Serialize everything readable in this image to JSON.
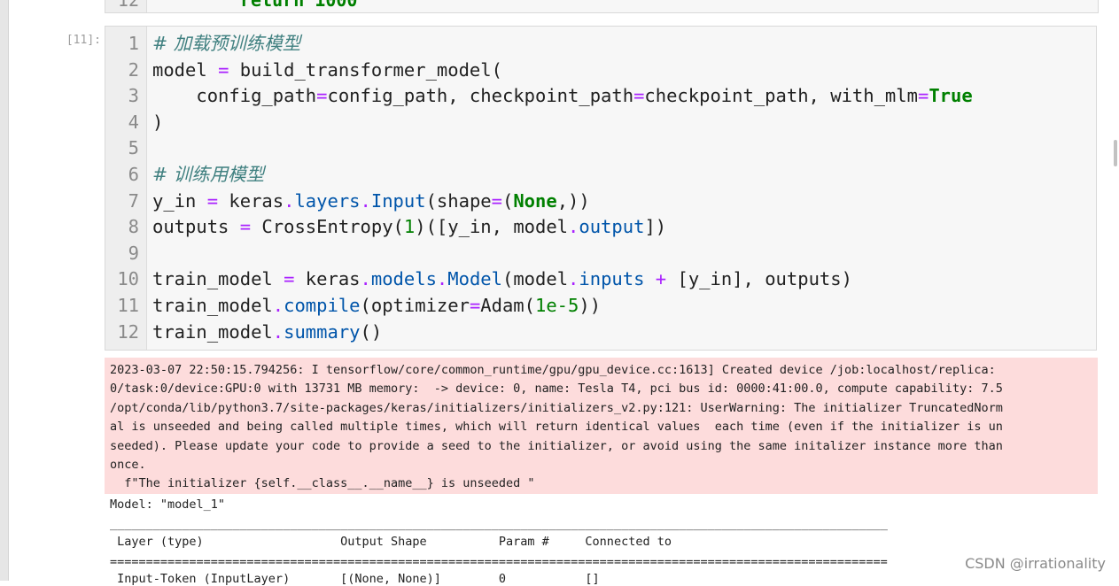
{
  "prev_cell": {
    "line_number": "12",
    "code": "return 1000"
  },
  "cell": {
    "prompt": "[11]:",
    "lines": [
      {
        "num": "1",
        "tokens": [
          {
            "t": "# 加载预训练模型",
            "c": "cm"
          }
        ]
      },
      {
        "num": "2",
        "tokens": [
          {
            "t": "model "
          },
          {
            "t": "=",
            "c": "op"
          },
          {
            "t": " build_transformer_model("
          }
        ]
      },
      {
        "num": "3",
        "tokens": [
          {
            "t": "    config_path"
          },
          {
            "t": "=",
            "c": "op"
          },
          {
            "t": "config_path, checkpoint_path"
          },
          {
            "t": "=",
            "c": "op"
          },
          {
            "t": "checkpoint_path, with_mlm"
          },
          {
            "t": "=",
            "c": "op"
          },
          {
            "t": "True",
            "c": "kw"
          }
        ]
      },
      {
        "num": "4",
        "tokens": [
          {
            "t": ")"
          }
        ]
      },
      {
        "num": "5",
        "tokens": []
      },
      {
        "num": "6",
        "tokens": [
          {
            "t": "# 训练用模型",
            "c": "cm"
          }
        ]
      },
      {
        "num": "7",
        "tokens": [
          {
            "t": "y_in "
          },
          {
            "t": "=",
            "c": "op"
          },
          {
            "t": " keras"
          },
          {
            "t": ".",
            "c": "op"
          },
          {
            "t": "layers",
            "c": "attr"
          },
          {
            "t": ".",
            "c": "op"
          },
          {
            "t": "Input",
            "c": "attr"
          },
          {
            "t": "(shape"
          },
          {
            "t": "=",
            "c": "op"
          },
          {
            "t": "("
          },
          {
            "t": "None",
            "c": "kw"
          },
          {
            "t": ",))"
          }
        ]
      },
      {
        "num": "8",
        "tokens": [
          {
            "t": "outputs "
          },
          {
            "t": "=",
            "c": "op"
          },
          {
            "t": " CrossEntropy("
          },
          {
            "t": "1",
            "c": "num"
          },
          {
            "t": ")([y_in, model"
          },
          {
            "t": ".",
            "c": "op"
          },
          {
            "t": "output",
            "c": "attr"
          },
          {
            "t": "])"
          }
        ]
      },
      {
        "num": "9",
        "tokens": []
      },
      {
        "num": "10",
        "tokens": [
          {
            "t": "train_model "
          },
          {
            "t": "=",
            "c": "op"
          },
          {
            "t": " keras"
          },
          {
            "t": ".",
            "c": "op"
          },
          {
            "t": "models",
            "c": "attr"
          },
          {
            "t": ".",
            "c": "op"
          },
          {
            "t": "Model",
            "c": "attr"
          },
          {
            "t": "(model"
          },
          {
            "t": ".",
            "c": "op"
          },
          {
            "t": "inputs",
            "c": "attr"
          },
          {
            "t": " "
          },
          {
            "t": "+",
            "c": "op"
          },
          {
            "t": " [y_in], outputs)"
          }
        ]
      },
      {
        "num": "11",
        "tokens": [
          {
            "t": "train_model"
          },
          {
            "t": ".",
            "c": "op"
          },
          {
            "t": "compile",
            "c": "attr"
          },
          {
            "t": "(optimizer"
          },
          {
            "t": "=",
            "c": "op"
          },
          {
            "t": "Adam("
          },
          {
            "t": "1e-5",
            "c": "num"
          },
          {
            "t": "))"
          }
        ]
      },
      {
        "num": "12",
        "tokens": [
          {
            "t": "train_model"
          },
          {
            "t": ".",
            "c": "op"
          },
          {
            "t": "summary",
            "c": "attr"
          },
          {
            "t": "()"
          }
        ]
      }
    ]
  },
  "stderr_lines": [
    "2023-03-07 22:50:15.794256: I tensorflow/core/common_runtime/gpu/gpu_device.cc:1613] Created device /job:localhost/replica:",
    "0/task:0/device:GPU:0 with 13731 MB memory:  -> device: 0, name: Tesla T4, pci bus id: 0000:41:00.0, compute capability: 7.5",
    "/opt/conda/lib/python3.7/site-packages/keras/initializers/initializers_v2.py:121: UserWarning: The initializer TruncatedNorm",
    "al is unseeded and being called multiple times, which will return identical values  each time (even if the initializer is un",
    "seeded). Please update your code to provide a seed to the initializer, or avoid using the same initalizer instance more than",
    "once.",
    "  f\"The initializer {self.__class__.__name__} is unseeded \""
  ],
  "summary": {
    "model_line": "Model: \"model_1\"",
    "underscore_rule": "_______________________________________________________________________________________________________________________",
    "header": " Layer (type)                   Output Shape          Param #     Connected to",
    "equals_rule": "=======================================================================================================================",
    "first_row": " Input-Token (InputLayer)       [(None, None)]        0           []"
  },
  "watermark": "CSDN @irrationality"
}
